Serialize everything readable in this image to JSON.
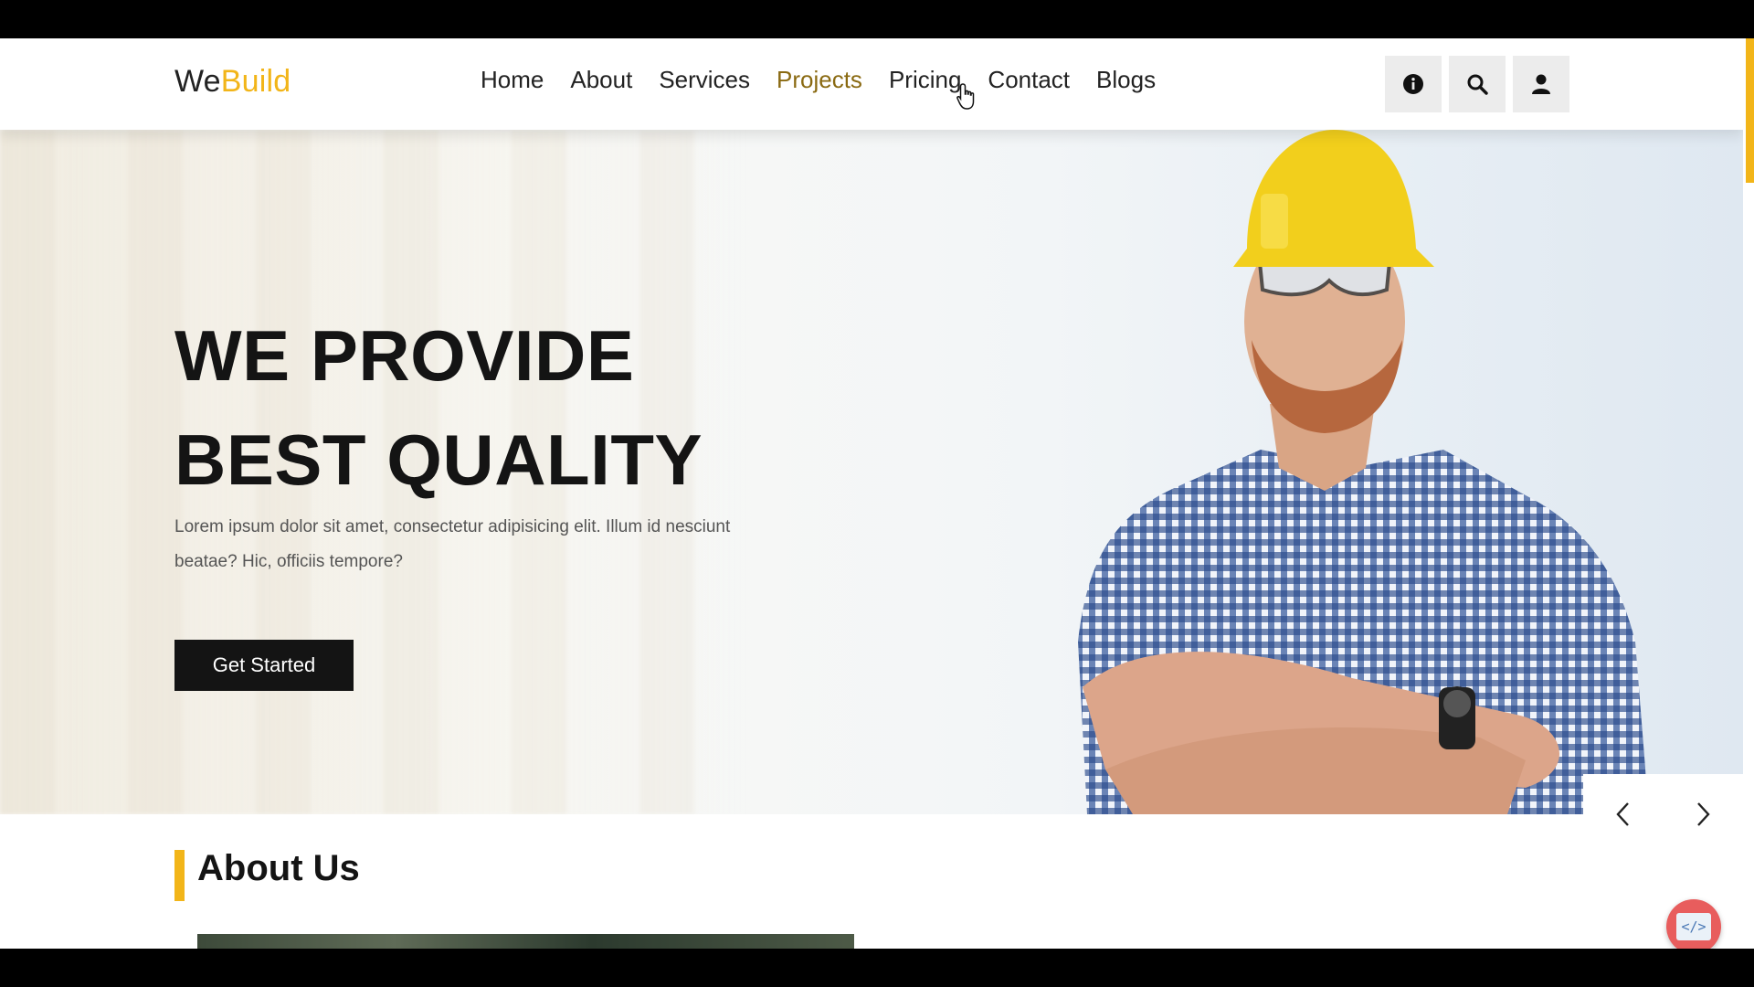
{
  "logo": {
    "part1": "We",
    "part2": "Build"
  },
  "nav": {
    "items": [
      {
        "label": "Home"
      },
      {
        "label": "About"
      },
      {
        "label": "Services"
      },
      {
        "label": "Projects",
        "active": true
      },
      {
        "label": "Pricing"
      },
      {
        "label": "Contact"
      },
      {
        "label": "Blogs"
      }
    ]
  },
  "header_icons": [
    "info-icon",
    "search-icon",
    "user-icon"
  ],
  "hero": {
    "title_line1": "WE PROVIDE",
    "title_line2": "BEST QUALITY",
    "text": "Lorem ipsum dolor sit amet, consectetur adipisicing elit. Illum id nesciunt beatae? Hic, officiis tempore?",
    "cta_label": "Get Started"
  },
  "about": {
    "title": "About Us"
  },
  "colors": {
    "accent": "#f2b519",
    "active_nav": "#8a6a12",
    "dark": "#141414",
    "fab": "#e85d5d"
  },
  "fab": {
    "label": "</>"
  }
}
